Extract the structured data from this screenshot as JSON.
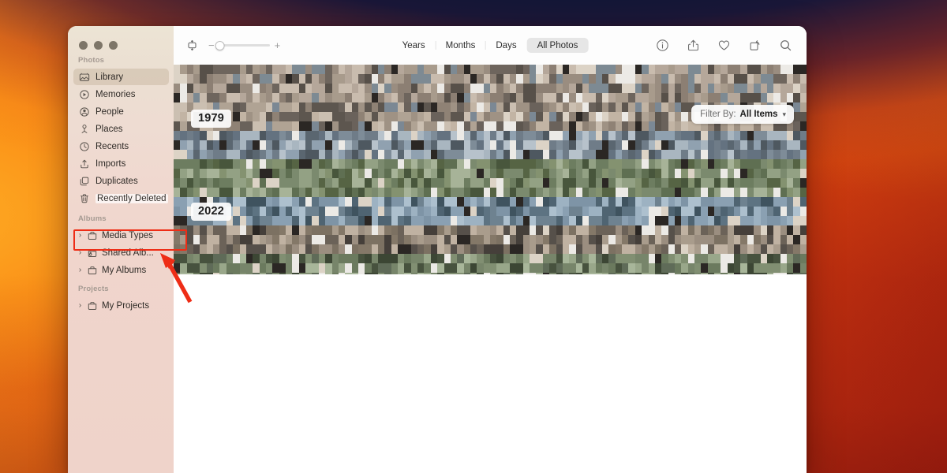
{
  "window": {
    "app_name": "Photos",
    "traffic_lights": [
      "close-button",
      "minimize-button",
      "maximize-button"
    ]
  },
  "sidebar": {
    "groups": [
      {
        "title": "Photos",
        "items": [
          {
            "label": "Library",
            "icon": "library-icon",
            "selected": true,
            "expandable": false,
            "highlighted": false
          },
          {
            "label": "Memories",
            "icon": "memories-icon",
            "selected": false,
            "expandable": false,
            "highlighted": false
          },
          {
            "label": "People",
            "icon": "people-icon",
            "selected": false,
            "expandable": false,
            "highlighted": false
          },
          {
            "label": "Places",
            "icon": "places-icon",
            "selected": false,
            "expandable": false,
            "highlighted": false
          },
          {
            "label": "Recents",
            "icon": "recents-icon",
            "selected": false,
            "expandable": false,
            "highlighted": false
          },
          {
            "label": "Imports",
            "icon": "imports-icon",
            "selected": false,
            "expandable": false,
            "highlighted": false
          },
          {
            "label": "Duplicates",
            "icon": "duplicates-icon",
            "selected": false,
            "expandable": false,
            "highlighted": false
          },
          {
            "label": "Recently Deleted",
            "icon": "trash-icon",
            "selected": false,
            "expandable": false,
            "highlighted": true
          }
        ]
      },
      {
        "title": "Albums",
        "items": [
          {
            "label": "Media Types",
            "icon": "album-icon",
            "selected": false,
            "expandable": true,
            "highlighted": false
          },
          {
            "label": "Shared Alb...",
            "icon": "shared-album-icon",
            "selected": false,
            "expandable": true,
            "highlighted": false
          },
          {
            "label": "My Albums",
            "icon": "album-icon",
            "selected": false,
            "expandable": true,
            "highlighted": false
          }
        ]
      },
      {
        "title": "Projects",
        "items": [
          {
            "label": "My Projects",
            "icon": "album-icon",
            "selected": false,
            "expandable": true,
            "highlighted": false
          }
        ]
      }
    ]
  },
  "toolbar": {
    "layout_toggle_icon": "aspect-layout-icon",
    "zoom_out_label": "−",
    "zoom_in_label": "+",
    "zoom_value_percent": 0,
    "segments": [
      {
        "label": "Years",
        "active": false
      },
      {
        "label": "Months",
        "active": false
      },
      {
        "label": "Days",
        "active": false
      },
      {
        "label": "All Photos",
        "active": true
      }
    ],
    "actions": [
      {
        "icon": "info-icon",
        "name": "info-button"
      },
      {
        "icon": "share-icon",
        "name": "share-button"
      },
      {
        "icon": "favorite-icon",
        "name": "favorite-button"
      },
      {
        "icon": "rotate-icon",
        "name": "rotate-button"
      },
      {
        "icon": "search-icon",
        "name": "search-button"
      }
    ]
  },
  "grid": {
    "year_labels": [
      "1979",
      "2022"
    ],
    "filter": {
      "label": "Filter By:",
      "value": "All Items",
      "chevron": "chevron-down-icon"
    }
  },
  "annotation": {
    "highlight_target": "Recently Deleted",
    "box_color": "#ee2d16",
    "arrow_color": "#ee2d16"
  }
}
